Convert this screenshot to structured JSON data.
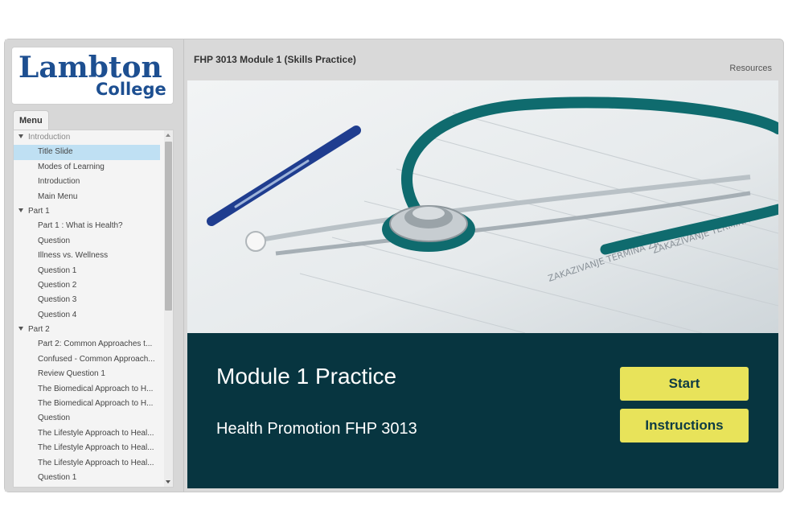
{
  "brand": {
    "line1": "Lambton",
    "line2": "College"
  },
  "course_title": "FHP 3013 Module 1 (Skills Practice)",
  "resources_label": "Resources",
  "menu": {
    "tab_label": "Menu",
    "items": [
      {
        "label": "Introduction",
        "type": "section",
        "dim": true
      },
      {
        "label": "Title Slide",
        "type": "child",
        "active": true
      },
      {
        "label": "Modes of Learning",
        "type": "child"
      },
      {
        "label": "Introduction",
        "type": "child"
      },
      {
        "label": "Main Menu",
        "type": "child"
      },
      {
        "label": "Part 1",
        "type": "section"
      },
      {
        "label": "Part 1 : What is Health?",
        "type": "child"
      },
      {
        "label": "Question",
        "type": "child"
      },
      {
        "label": "Illness vs. Wellness",
        "type": "child"
      },
      {
        "label": "Question 1",
        "type": "child"
      },
      {
        "label": "Question 2",
        "type": "child"
      },
      {
        "label": "Question 3",
        "type": "child"
      },
      {
        "label": "Question 4",
        "type": "child"
      },
      {
        "label": "Part 2",
        "type": "section"
      },
      {
        "label": "Part 2: Common Approaches t...",
        "type": "child"
      },
      {
        "label": "Confused - Common Approach...",
        "type": "child"
      },
      {
        "label": "Review Question 1",
        "type": "child"
      },
      {
        "label": "The Biomedical Approach to H...",
        "type": "child"
      },
      {
        "label": "The Biomedical Approach to H...",
        "type": "child"
      },
      {
        "label": "Question",
        "type": "child"
      },
      {
        "label": "The Lifestyle Approach to Heal...",
        "type": "child"
      },
      {
        "label": "The Lifestyle Approach to Heal...",
        "type": "child"
      },
      {
        "label": "The Lifestyle Approach to Heal...",
        "type": "child"
      },
      {
        "label": "Question 1",
        "type": "child"
      }
    ]
  },
  "slide": {
    "title": "Module 1 Practice",
    "subtitle": "Health Promotion FHP 3013",
    "start_label": "Start",
    "instructions_label": "Instructions"
  },
  "colors": {
    "banner": "#073540",
    "button": "#e8e35a",
    "logo_blue": "#1d4f91",
    "active_item": "#bfe0f3"
  }
}
